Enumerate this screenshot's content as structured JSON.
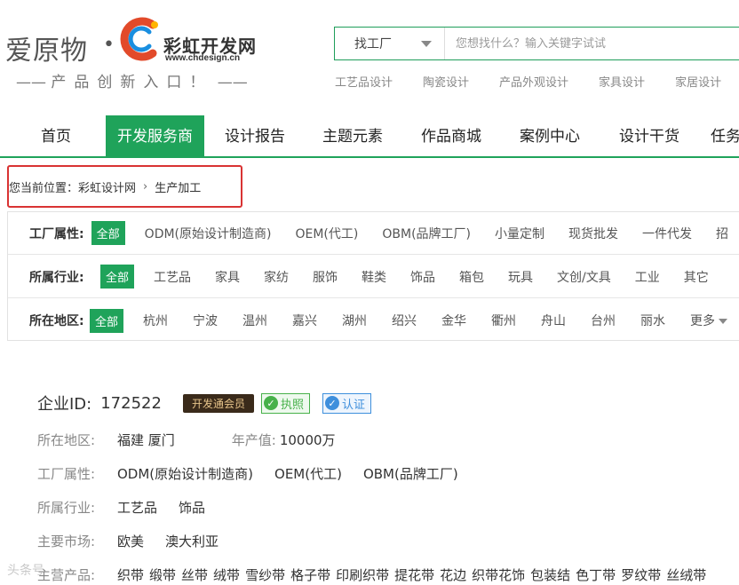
{
  "logo": {
    "main": "爱原物",
    "dot": "•",
    "brand": "彩虹开发网",
    "url": "www.chdesign.cn",
    "slogan": "产品创新入口！",
    "brand_colors": [
      "#e24a2a",
      "#1a8fe0",
      "#ffb400"
    ]
  },
  "search": {
    "select_value": "找工厂",
    "placeholder": "您想找什么？输入关键字试试"
  },
  "hot_links": [
    "工艺品设计",
    "陶瓷设计",
    "产品外观设计",
    "家具设计",
    "家居设计"
  ],
  "nav": {
    "items": [
      "首页",
      "开发服务商",
      "设计报告",
      "主题元素",
      "作品商城",
      "案例中心",
      "设计干货",
      "任务"
    ],
    "active": "开发服务商"
  },
  "breadcrumb": {
    "prefix": "您当前位置：",
    "home": "彩虹设计网",
    "current": "生产加工"
  },
  "filters": {
    "all_label": "全部",
    "factory": {
      "label": "工厂属性:",
      "options": [
        "ODM(原始设计制造商)",
        "OEM(代工)",
        "OBM(品牌工厂)",
        "小量定制",
        "现货批发",
        "一件代发",
        "招"
      ]
    },
    "industry": {
      "label": "所属行业:",
      "options": [
        "工艺品",
        "家具",
        "家纺",
        "服饰",
        "鞋类",
        "饰品",
        "箱包",
        "玩具",
        "文创/文具",
        "工业",
        "其它"
      ]
    },
    "region": {
      "label": "所在地区:",
      "options": [
        "杭州",
        "宁波",
        "温州",
        "嘉兴",
        "湖州",
        "绍兴",
        "金华",
        "衢州",
        "舟山",
        "台州",
        "丽水"
      ],
      "more": "更多"
    }
  },
  "company": {
    "id_label": "企业ID:",
    "id_value": "172522",
    "member_badge": "开发通会员",
    "license_badge": "执照",
    "cert_badge": "认证",
    "region_label": "所在地区:",
    "region_value": "福建 厦门",
    "output_label": "年产值:",
    "output_value": "10000万",
    "factory_label": "工厂属性:",
    "factory_values": [
      "ODM(原始设计制造商)",
      "OEM(代工)",
      "OBM(品牌工厂)"
    ],
    "industry_label": "所属行业:",
    "industry_values": [
      "工艺品",
      "饰品"
    ],
    "market_label": "主要市场:",
    "market_values": [
      "欧美",
      "澳大利亚"
    ],
    "products_label": "主营产品:",
    "products_values": [
      "织带",
      "缎带",
      "丝带",
      "绒带",
      "雪纱带",
      "格子带",
      "印刷织带",
      "提花带",
      "花边",
      "织带花饰",
      "包装结",
      "色丁带",
      "罗纹带",
      "丝绒带"
    ]
  },
  "watermark": "头条号"
}
